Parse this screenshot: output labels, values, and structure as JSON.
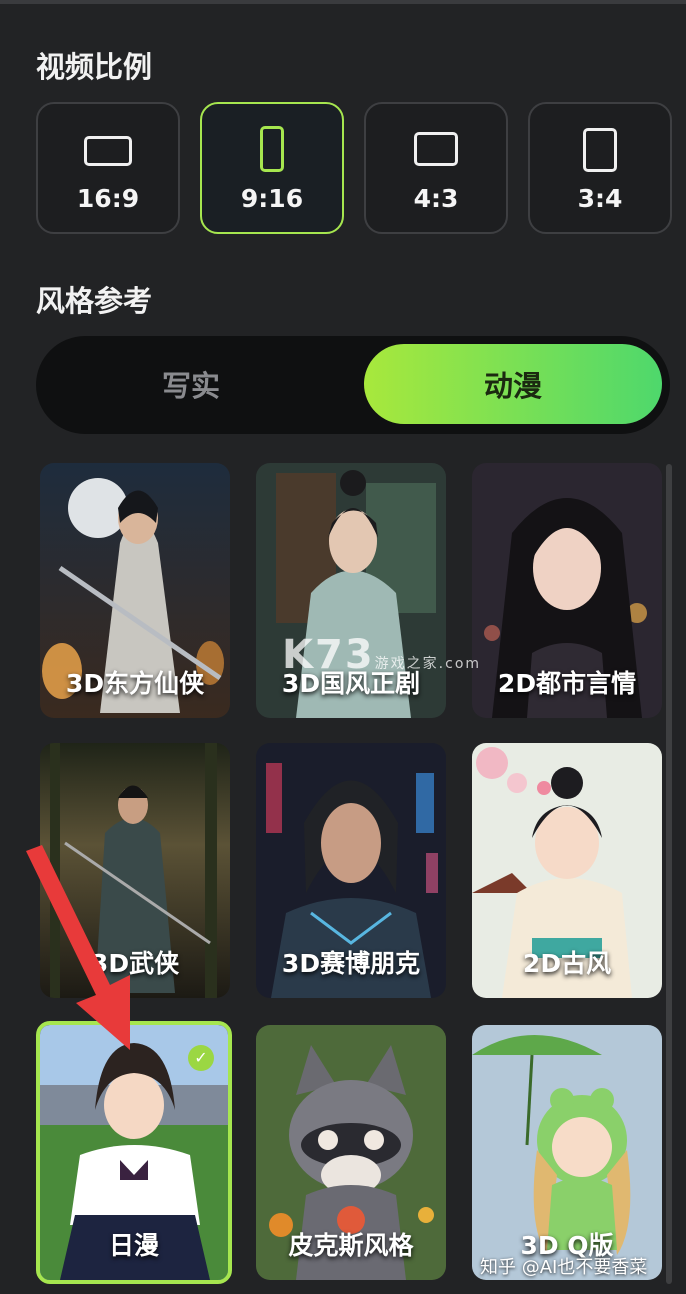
{
  "aspect": {
    "title": "视频比例",
    "options": [
      {
        "label": "16:9",
        "icon": "landscape-rect-icon",
        "selected": false
      },
      {
        "label": "9:16",
        "icon": "portrait-rect-icon",
        "selected": true
      },
      {
        "label": "4:3",
        "icon": "landscape-rect-icon",
        "selected": false
      },
      {
        "label": "3:4",
        "icon": "portrait-rect-icon",
        "selected": false
      }
    ]
  },
  "style": {
    "title": "风格参考",
    "tabs": [
      {
        "label": "写实",
        "selected": false
      },
      {
        "label": "动漫",
        "selected": true
      }
    ],
    "cards": [
      {
        "label": "3D东方仙侠",
        "selected": false
      },
      {
        "label": "3D国风正剧",
        "selected": false
      },
      {
        "label": "2D都市言情",
        "selected": false
      },
      {
        "label": "3D武侠",
        "selected": false
      },
      {
        "label": "3D赛博朋克",
        "selected": false
      },
      {
        "label": "2D古风",
        "selected": false
      },
      {
        "label": "日漫",
        "selected": true
      },
      {
        "label": "皮克斯风格",
        "selected": false
      },
      {
        "label": "3D Q版",
        "selected": false
      }
    ]
  },
  "watermark": {
    "site_main": "K73",
    "site_sub": "游戏之家",
    "site_domain": ".com"
  },
  "credit": "知乎 @AI也不要香菜",
  "colors": {
    "accent": "#a6e64f",
    "background": "#222325",
    "gradient_end": "#4ed86c"
  }
}
